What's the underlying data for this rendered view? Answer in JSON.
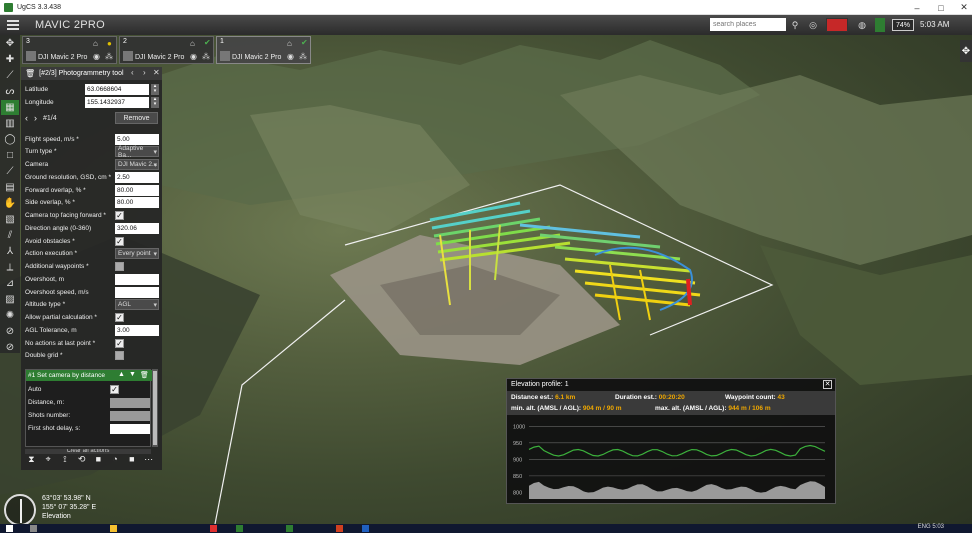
{
  "window": {
    "title": "UgCS 3.3.438",
    "minimize": "–",
    "maximize": "□",
    "close": "✕"
  },
  "app_bar": {
    "title": "MAVIC 2PRO",
    "search_placeholder": "search places",
    "battery": "74%",
    "time": "5:03 AM"
  },
  "drones": [
    {
      "num": "3",
      "name": "DJI Mavic 2 Pro"
    },
    {
      "num": "2",
      "name": "DJI Mavic 2 Pro"
    },
    {
      "num": "1",
      "name": "DJI Mavic 2 Pro"
    }
  ],
  "panel": {
    "title": "[#2/3] Photogrammetry tool",
    "latitude_label": "Latitude",
    "latitude": "63.0668604",
    "longitude_label": "Longitude",
    "longitude": "155.1432937",
    "waypoint": "#1/4",
    "remove": "Remove",
    "fields": [
      {
        "label": "Flight speed, m/s *",
        "value": "5.00",
        "kind": "input"
      },
      {
        "label": "Turn type *",
        "value": "Adaptive Ba...",
        "kind": "dropdown"
      },
      {
        "label": "Camera",
        "value": "DJI Mavic 2...",
        "kind": "dropdown"
      },
      {
        "label": "Ground resolution, GSD, cm *",
        "value": "2.50",
        "kind": "input"
      },
      {
        "label": "Forward overlap, % *",
        "value": "80.00",
        "kind": "input"
      },
      {
        "label": "Side overlap, % *",
        "value": "80.00",
        "kind": "input"
      },
      {
        "label": "Camera top facing forward *",
        "value": "✓",
        "kind": "check"
      },
      {
        "label": "Direction angle (0-360)",
        "value": "320.06",
        "kind": "input"
      },
      {
        "label": "Avoid obstacles *",
        "value": "✓",
        "kind": "check"
      },
      {
        "label": "Action execution *",
        "value": "Every point",
        "kind": "dropdown"
      },
      {
        "label": "Additional waypoints *",
        "value": "",
        "kind": "check-off"
      },
      {
        "label": "Overshoot, m",
        "value": "",
        "kind": "input"
      },
      {
        "label": "Overshoot speed, m/s",
        "value": "",
        "kind": "input"
      },
      {
        "label": "Altitude type *",
        "value": "AGL",
        "kind": "dropdown"
      },
      {
        "label": "Allow partial calculation *",
        "value": "✓",
        "kind": "check"
      },
      {
        "label": "AGL Tolerance, m",
        "value": "3.00",
        "kind": "input"
      },
      {
        "label": "No actions at last point *",
        "value": "✓",
        "kind": "check"
      },
      {
        "label": "Double grid *",
        "value": "",
        "kind": "check-off"
      }
    ],
    "action": {
      "title": "#1 Set camera by distance",
      "auto_label": "Auto",
      "auto_value": "✓",
      "distance_label": "Distance, m:",
      "shots_label": "Shots number:",
      "delay_label": "First shot delay, s:"
    },
    "clear_all": "Clear all actions"
  },
  "elevation": {
    "title": "Elevation profile: 1",
    "distance_label": "Distance est.:",
    "distance": "6.1 km",
    "duration_label": "Duration est.:",
    "duration": "00:20:20",
    "waypoint_label": "Waypoint count:",
    "waypoint_count": "43",
    "min_label": "min. alt. (AMSL / AGL):",
    "min_value": "904 m / 90 m",
    "max_label": "max. alt. (AMSL / AGL):",
    "max_value": "944 m / 106 m",
    "y_ticks": [
      "1000",
      "950",
      "900",
      "850",
      "800"
    ],
    "y_range": [
      780,
      1010
    ]
  },
  "status": {
    "lat": "63°03' 53.98\" N",
    "lon": "155° 07' 35.28\" E",
    "elevation_prefix": "Elevation"
  },
  "taskbar": {
    "tray_lang": "ENG",
    "tray_time": "5:03"
  }
}
